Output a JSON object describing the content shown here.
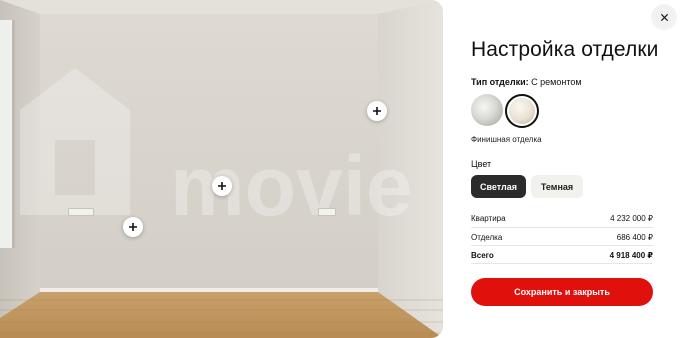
{
  "panel": {
    "title": "Настройка отделки",
    "finish_type_label": "Тип отделки:",
    "finish_type_value": "С ремонтом",
    "finish_swatches": [
      {
        "name": "white-finish",
        "selected": false
      },
      {
        "name": "beige-finish",
        "selected": true
      }
    ],
    "finish_caption": "Финишная отделка",
    "color_label": "Цвет",
    "color_options": [
      {
        "label": "Светлая",
        "selected": true
      },
      {
        "label": "Темная",
        "selected": false
      }
    ],
    "prices": [
      {
        "label": "Квартира",
        "value": "4 232 000 ₽"
      },
      {
        "label": "Отделка",
        "value": "686 400 ₽"
      },
      {
        "label": "Всего",
        "value": "4 918 400 ₽"
      }
    ],
    "save_label": "Сохранить и закрыть",
    "accent_color": "#e0100d"
  },
  "preview": {
    "watermark": "movie",
    "hotspot_count": 3
  },
  "icons": {
    "close": "close-icon",
    "hotspot": "plus-icon"
  }
}
